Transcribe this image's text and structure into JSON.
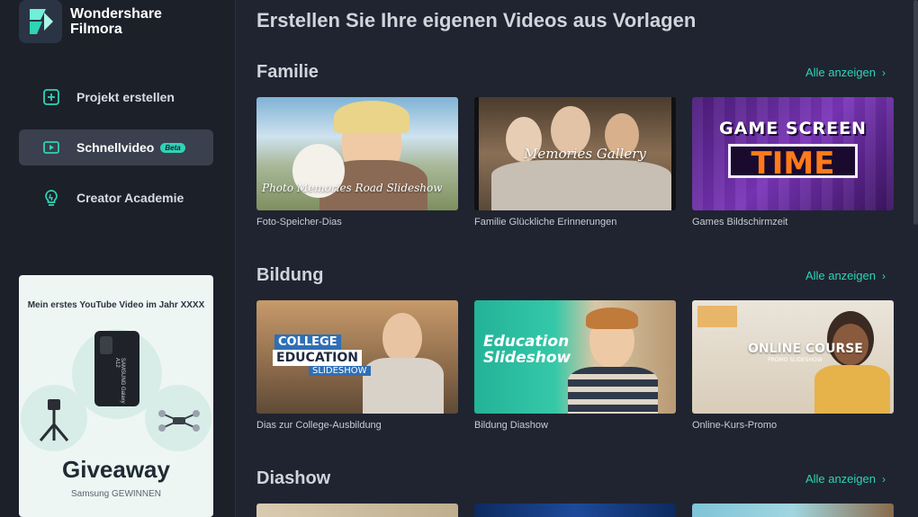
{
  "app": {
    "brand_line1": "Wondershare",
    "brand_line2": "Filmora"
  },
  "sidebar": {
    "items": [
      {
        "label": "Projekt erstellen",
        "icon": "plus-square-icon",
        "active": false
      },
      {
        "label": "Schnellvideo",
        "icon": "quick-video-icon",
        "active": true,
        "badge": "Beta"
      },
      {
        "label": "Creator Academie",
        "icon": "lightbulb-icon",
        "active": false
      }
    ],
    "promo": {
      "title": "Mein erstes YouTube Video im Jahr XXXX",
      "phone_text": "SAMSUNG Galaxy A12",
      "headline": "Giveaway",
      "subline": "Samsung GEWINNEN"
    }
  },
  "main": {
    "title": "Erstellen Sie Ihre eigenen Videos aus Vorlagen",
    "see_all": "Alle anzeigen",
    "sections": [
      {
        "title": "Familie",
        "cards": [
          {
            "label": "Foto-Speicher-Dias",
            "overlay": "Photo Memories Road Slideshow"
          },
          {
            "label": "Familie Glückliche Erinnerungen",
            "overlay": "Memories Gallery"
          },
          {
            "label": "Games Bildschirmzeit",
            "overlay_line1": "GAME SCREEN",
            "overlay_line2": "TIME"
          }
        ]
      },
      {
        "title": "Bildung",
        "cards": [
          {
            "label": "Dias zur College-Ausbildung",
            "overlay_line1": "COLLEGE",
            "overlay_line2": "EDUCATION",
            "overlay_line3": "SLIDESHOW"
          },
          {
            "label": "Bildung Diashow",
            "overlay_line1": "Education",
            "overlay_line2": "Slideshow"
          },
          {
            "label": "Online-Kurs-Promo",
            "overlay_line1": "ONLINE COURSE",
            "overlay_line2": "PROMO SLIDESHOW"
          }
        ]
      },
      {
        "title": "Diashow",
        "cards": [
          {
            "label": ""
          },
          {
            "label": ""
          },
          {
            "label": ""
          }
        ]
      }
    ]
  },
  "colors": {
    "accent": "#2fd3b6",
    "background": "#1f2430",
    "sidebar": "#1c2029"
  }
}
